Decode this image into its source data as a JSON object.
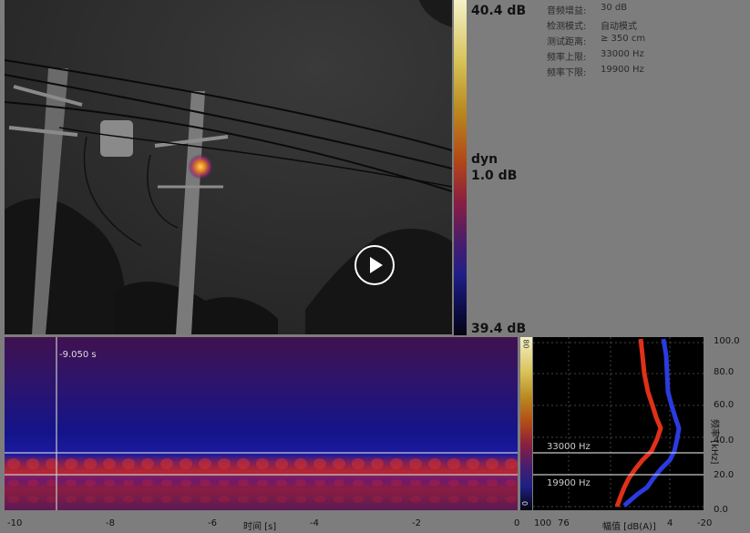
{
  "camera": {
    "scale_max": "40.4 dB",
    "scale_mode": "dyn",
    "scale_range": "1.0 dB",
    "scale_min": "39.4 dB",
    "play_label": "play"
  },
  "info": [
    {
      "label": "音频增益:",
      "value": "30 dB"
    },
    {
      "label": "检测模式:",
      "value": "自动模式"
    },
    {
      "label": "测试距离:",
      "value": "≥ 350 cm"
    },
    {
      "label": "频率上限:",
      "value": "33000 Hz"
    },
    {
      "label": "频率下限:",
      "value": "19900 Hz"
    }
  ],
  "spectrogram": {
    "cursor_time": "-9.050 s",
    "xlabel": "时间 [s]",
    "xticks": [
      "-10",
      "-8",
      "-6",
      "-4",
      "-2",
      "0"
    ]
  },
  "mini_colorbar": {
    "top": "80",
    "bottom": "0"
  },
  "profile": {
    "upper_line": "33000 Hz",
    "lower_line": "19900 Hz",
    "xlabel": "幅值 [dB(A)]",
    "xticks": [
      "100",
      "76",
      "4",
      "-20"
    ],
    "yticks": [
      "100.0",
      "80.0",
      "60.0",
      "40.0",
      "20.0",
      "0.0"
    ],
    "ylabel": "频率 [kHz]"
  }
}
